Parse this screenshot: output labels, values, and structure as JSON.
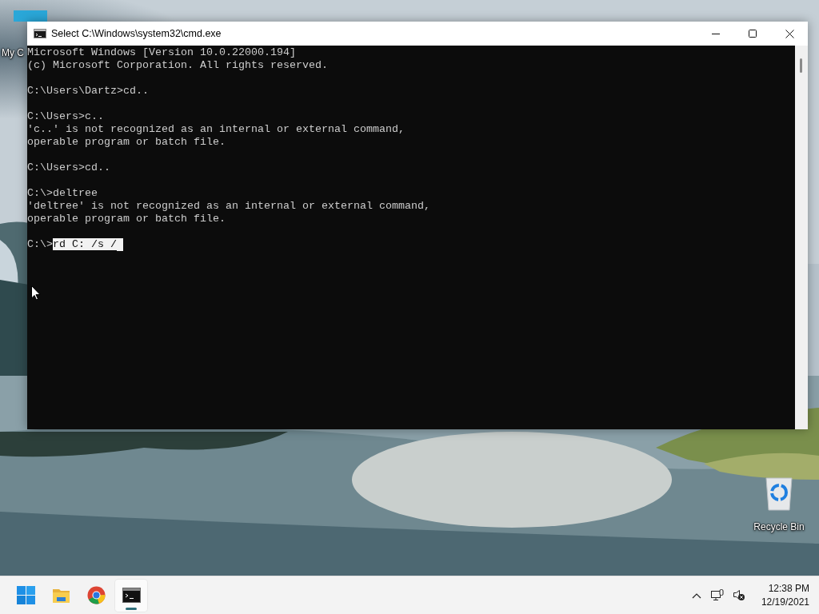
{
  "desktop_icons": [
    {
      "kind": "monitor",
      "label": "My C"
    },
    {
      "kind": "recycle",
      "label": "Recycle Bin"
    }
  ],
  "window": {
    "title": "Select C:\\Windows\\system32\\cmd.exe"
  },
  "console": {
    "blocks": [
      [
        "Microsoft Windows [Version 10.0.22000.194]",
        "(c) Microsoft Corporation. All rights reserved."
      ],
      [
        "C:\\Users\\Dartz>cd.."
      ],
      [
        "C:\\Users>c..",
        "'c..' is not recognized as an internal or external command,",
        "operable program or batch file."
      ],
      [
        "C:\\Users>cd.."
      ],
      [
        "C:\\>deltree",
        "'deltree' is not recognized as an internal or external command,",
        "operable program or batch file."
      ]
    ],
    "input": {
      "prompt": "C:\\>",
      "typed": "rd C: /s /",
      "selected": true
    }
  },
  "taskbar": {
    "apps": [
      {
        "kind": "start",
        "selected": false
      },
      {
        "kind": "folder",
        "selected": false
      },
      {
        "kind": "browser",
        "selected": false
      },
      {
        "kind": "terminal",
        "selected": true
      }
    ],
    "time": "12:38 PM",
    "date": "12/19/2021"
  }
}
